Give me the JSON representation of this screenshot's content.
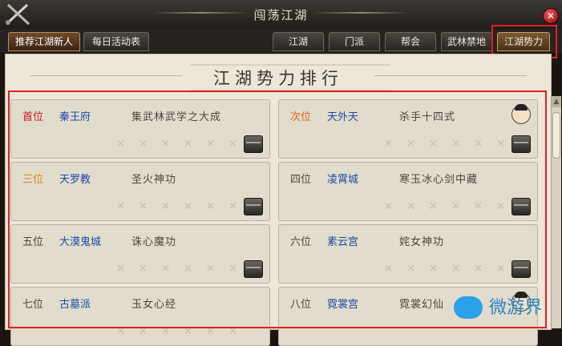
{
  "window": {
    "title": "闯荡江湖"
  },
  "tabs_left": [
    {
      "label": "推荐江湖新人",
      "active": true
    },
    {
      "label": "每日活动表",
      "active": false
    }
  ],
  "tabs_right": [
    {
      "label": "江湖"
    },
    {
      "label": "门派"
    },
    {
      "label": "帮会"
    },
    {
      "label": "武林禁地"
    },
    {
      "label": "江湖势力",
      "selected": true
    }
  ],
  "heading": "江湖势力排行",
  "ranks": [
    {
      "rank": "首位",
      "name": "秦王府",
      "skill": "集武林武学之大成",
      "rank_color": "#c0141c"
    },
    {
      "rank": "次位",
      "name": "天外天",
      "skill": "杀手十四式",
      "rank_color": "#e0601c",
      "avatar": true
    },
    {
      "rank": "三位",
      "name": "天罗教",
      "skill": "圣火神功",
      "rank_color": "#d08a10"
    },
    {
      "rank": "四位",
      "name": "凌霄城",
      "skill": "寒玉冰心剑中藏",
      "rank_color": "#4a4640"
    },
    {
      "rank": "五位",
      "name": "大漠鬼城",
      "skill": "诛心魔功",
      "rank_color": "#4a4640"
    },
    {
      "rank": "六位",
      "name": "素云宫",
      "skill": "姹女神功",
      "rank_color": "#4a4640"
    },
    {
      "rank": "七位",
      "name": "古墓派",
      "skill": "玉女心经",
      "rank_color": "#4a4640"
    },
    {
      "rank": "八位",
      "name": "霓裳宫",
      "skill": "霓裳幻仙",
      "rank_color": "#4a4640",
      "avatar": true
    }
  ],
  "watermark": {
    "text": "微游界"
  }
}
